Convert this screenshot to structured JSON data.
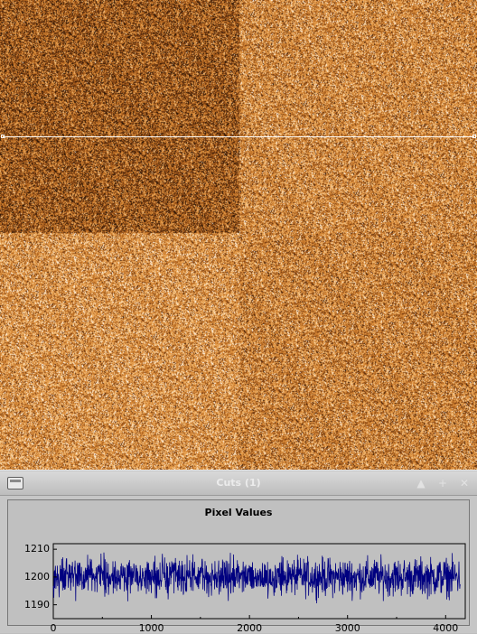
{
  "image_viewer": {
    "colormap": [
      "#1e0e04",
      "#6a3410",
      "#b5661e",
      "#e69a46",
      "#f7c889",
      "#ffffff"
    ]
  },
  "cuts_window": {
    "title": "Cuts (1)",
    "buttons": {
      "minimize_icon": "▲",
      "maximize_icon": "+",
      "close_icon": "✕"
    }
  },
  "colors": {
    "series": "#000080",
    "plot_background": "#c0c0c0",
    "cut_line": "#ffffff"
  },
  "chart_data": {
    "type": "line",
    "title": "Pixel Values",
    "xlabel": "",
    "ylabel": "",
    "xlim": [
      0,
      4200
    ],
    "ylim": [
      1185,
      1212
    ],
    "x_ticks": [
      0,
      1000,
      2000,
      3000,
      4000
    ],
    "y_ticks": [
      1190,
      1200,
      1210
    ],
    "series": [
      {
        "x_range": [
          0,
          4150
        ],
        "mean": 1200,
        "noise_range": [
          1190,
          1210
        ]
      }
    ]
  }
}
